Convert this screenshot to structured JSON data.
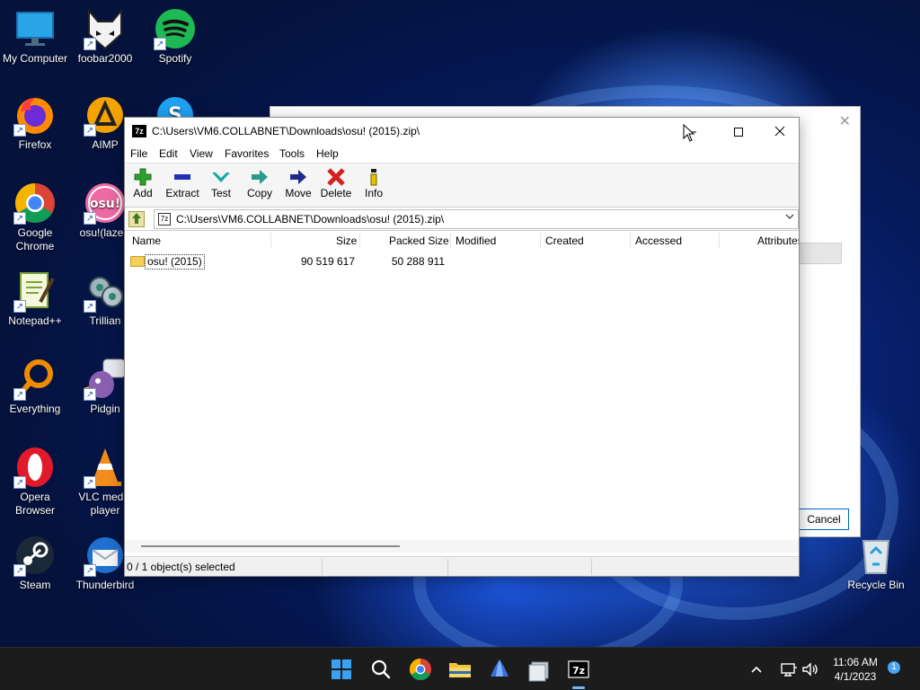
{
  "desktop": {
    "icons": [
      {
        "label": "My Computer",
        "icon": "monitor-icon"
      },
      {
        "label": "foobar2000",
        "icon": "foobar-icon"
      },
      {
        "label": "Spotify",
        "icon": "spotify-icon"
      },
      {
        "label": "Firefox",
        "icon": "firefox-icon"
      },
      {
        "label": "AIMP",
        "icon": "aimp-icon"
      },
      {
        "label": "Google Chrome",
        "icon": "chrome-icon"
      },
      {
        "label": "osu!(lazer)",
        "icon": "osu-icon"
      },
      {
        "label": "Notepad++",
        "icon": "notepadpp-icon"
      },
      {
        "label": "Trillian",
        "icon": "trillian-icon"
      },
      {
        "label": "Everything",
        "icon": "everything-icon"
      },
      {
        "label": "Pidgin",
        "icon": "pidgin-icon"
      },
      {
        "label": "Opera Browser",
        "icon": "opera-icon"
      },
      {
        "label": "VLC media player",
        "icon": "vlc-icon"
      },
      {
        "label": "Steam",
        "icon": "steam-icon"
      },
      {
        "label": "Thunderbird",
        "icon": "thunderbird-icon"
      },
      {
        "label": "Recycle Bin",
        "icon": "recycle-bin-icon"
      }
    ]
  },
  "background_dialog": {
    "close_glyph": "✕",
    "cancel_label": "Cancel"
  },
  "window": {
    "title": "C:\\Users\\VM6.COLLABNET\\Downloads\\osu! (2015).zip\\",
    "app_icon_text": "7z",
    "menu": [
      "File",
      "Edit",
      "View",
      "Favorites",
      "Tools",
      "Help"
    ],
    "toolbar": [
      {
        "label": "Add",
        "icon": "add-icon",
        "color": "#2ca02c"
      },
      {
        "label": "Extract",
        "icon": "extract-icon",
        "color": "#1f2fb8"
      },
      {
        "label": "Test",
        "icon": "test-icon",
        "color": "#1aa7a7"
      },
      {
        "label": "Copy",
        "icon": "copy-icon",
        "color": "#2a9a8a"
      },
      {
        "label": "Move",
        "icon": "move-icon",
        "color": "#1f2a8a"
      },
      {
        "label": "Delete",
        "icon": "delete-icon",
        "color": "#d21f1f"
      },
      {
        "label": "Info",
        "icon": "info-icon",
        "color": "#c9a100"
      }
    ],
    "address": "C:\\Users\\VM6.COLLABNET\\Downloads\\osu! (2015).zip\\",
    "columns": [
      "Name",
      "Size",
      "Packed Size",
      "Modified",
      "Created",
      "Accessed",
      "Attributes"
    ],
    "rows": [
      {
        "name": "osu! (2015)",
        "size": "90 519 617",
        "packed_size": "50 288 911",
        "modified": "",
        "created": "",
        "accessed": "",
        "attributes": ""
      }
    ],
    "status": "0 / 1 object(s) selected"
  },
  "taskbar": {
    "apps": [
      {
        "name": "start",
        "icon": "windows-start-icon"
      },
      {
        "name": "search",
        "icon": "search-icon"
      },
      {
        "name": "chrome",
        "icon": "chrome-icon"
      },
      {
        "name": "file-explorer",
        "icon": "folder-icon"
      },
      {
        "name": "app",
        "icon": "blue-app-icon"
      },
      {
        "name": "app2",
        "icon": "grey-app-icon"
      },
      {
        "name": "7-zip",
        "icon": "7zip-icon",
        "text": "7z"
      }
    ],
    "time": "11:06 AM",
    "date": "4/1/2023",
    "notification_count": "1"
  },
  "colors": {
    "taskbar": "#1c1c1c",
    "accent": "#0067c0"
  }
}
